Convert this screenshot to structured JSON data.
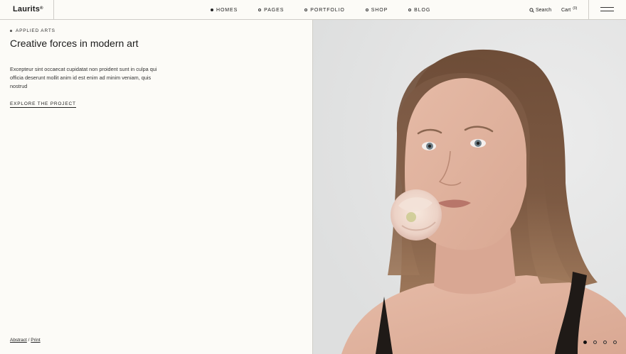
{
  "brand": {
    "name": "Laurits",
    "mark": "®"
  },
  "nav": [
    {
      "label": "HOMES",
      "active": true
    },
    {
      "label": "PAGES",
      "active": false
    },
    {
      "label": "PORTFOLIO",
      "active": false
    },
    {
      "label": "SHOP",
      "active": false
    },
    {
      "label": "BLOG",
      "active": false
    }
  ],
  "header": {
    "search_label": "Search",
    "cart_label": "Cart",
    "cart_count": "(0)"
  },
  "hero": {
    "eyebrow": "APPLIED ARTS",
    "title": "Creative forces in modern art",
    "description": "Excepteur sint occaecat cupidatat non proident sunt in culpa qui officia deserunt mollit anim id est enim ad minim veniam, quis nostrud",
    "cta": "EXPLORE THE PROJECT"
  },
  "tags": {
    "first": "Abstract",
    "separator": " / ",
    "second": "Print"
  },
  "pagination": {
    "total": 4,
    "active_index": 0
  },
  "icons": [
    "search-icon",
    "hamburger-menu-icon"
  ]
}
